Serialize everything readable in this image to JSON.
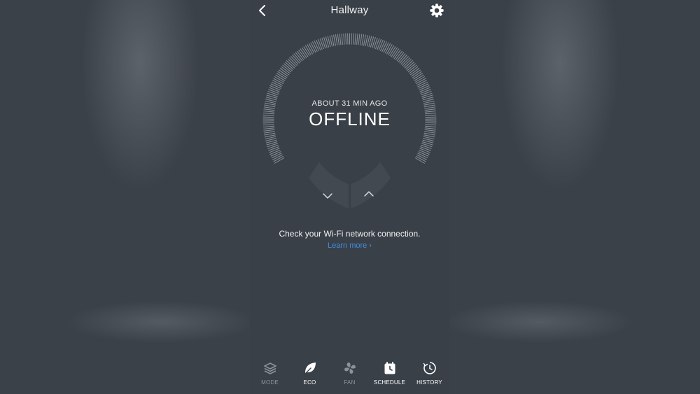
{
  "header": {
    "title": "Hallway"
  },
  "status": {
    "last_seen": "ABOUT 31 MIN AGO",
    "state": "OFFLINE",
    "message": "Check your Wi-Fi network connection.",
    "learn_more": "Learn more ›"
  },
  "icons": {
    "back": "chevron-left-icon",
    "settings": "gear-icon",
    "down": "chevron-down-icon",
    "up": "chevron-up-icon"
  },
  "colors": {
    "link": "#3f8fe0",
    "background": "#3a4048",
    "dim_label": "#8c9299"
  },
  "tabs": [
    {
      "label": "MODE",
      "icon": "layers-icon",
      "enabled": false
    },
    {
      "label": "ECO",
      "icon": "leaf-icon",
      "enabled": true
    },
    {
      "label": "FAN",
      "icon": "fan-icon",
      "enabled": false
    },
    {
      "label": "SCHEDULE",
      "icon": "calendar-clock-icon",
      "enabled": true
    },
    {
      "label": "HISTORY",
      "icon": "history-icon",
      "enabled": true
    }
  ]
}
